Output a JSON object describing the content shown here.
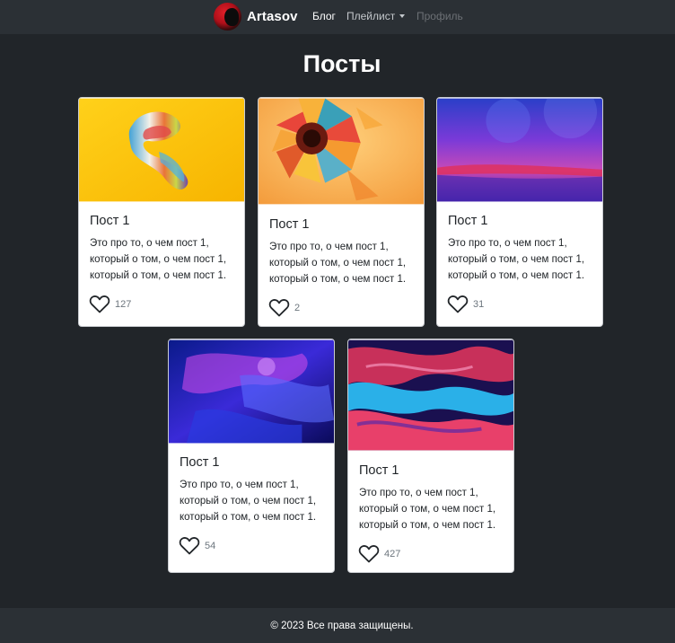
{
  "navbar": {
    "brand": "Artasov",
    "links": [
      "Блог",
      "Плейлист",
      "Профиль"
    ]
  },
  "page": {
    "title": "Посты"
  },
  "posts": [
    {
      "title": "Пост 1",
      "lines": [
        "Это про то, о чем пост 1,",
        "который о том, о чем пост 1,",
        "который о том, о чем пост 1."
      ],
      "likes": "127"
    },
    {
      "title": "Пост 1",
      "lines": [
        "Это про то, о чем пост 1,",
        "который о том, о чем пост 1,",
        "который о том, о чем пост 1."
      ],
      "likes": "2"
    },
    {
      "title": "Пост 1",
      "lines": [
        "Это про то, о чем пост 1,",
        "который о том, о чем пост 1,",
        "который о том, о чем пост 1."
      ],
      "likes": "31"
    },
    {
      "title": "Пост 1",
      "lines": [
        "Это про то, о чем пост 1,",
        "который о том, о чем пост 1,",
        "который о том, о чем пост 1."
      ],
      "likes": "54"
    },
    {
      "title": "Пост 1",
      "lines": [
        "Это про то, о чем пост 1,",
        "который о том, о чем пост 1,",
        "который о том, о чем пост 1."
      ],
      "likes": "427"
    }
  ],
  "footer": {
    "text": "© 2023 Все права защищены."
  }
}
